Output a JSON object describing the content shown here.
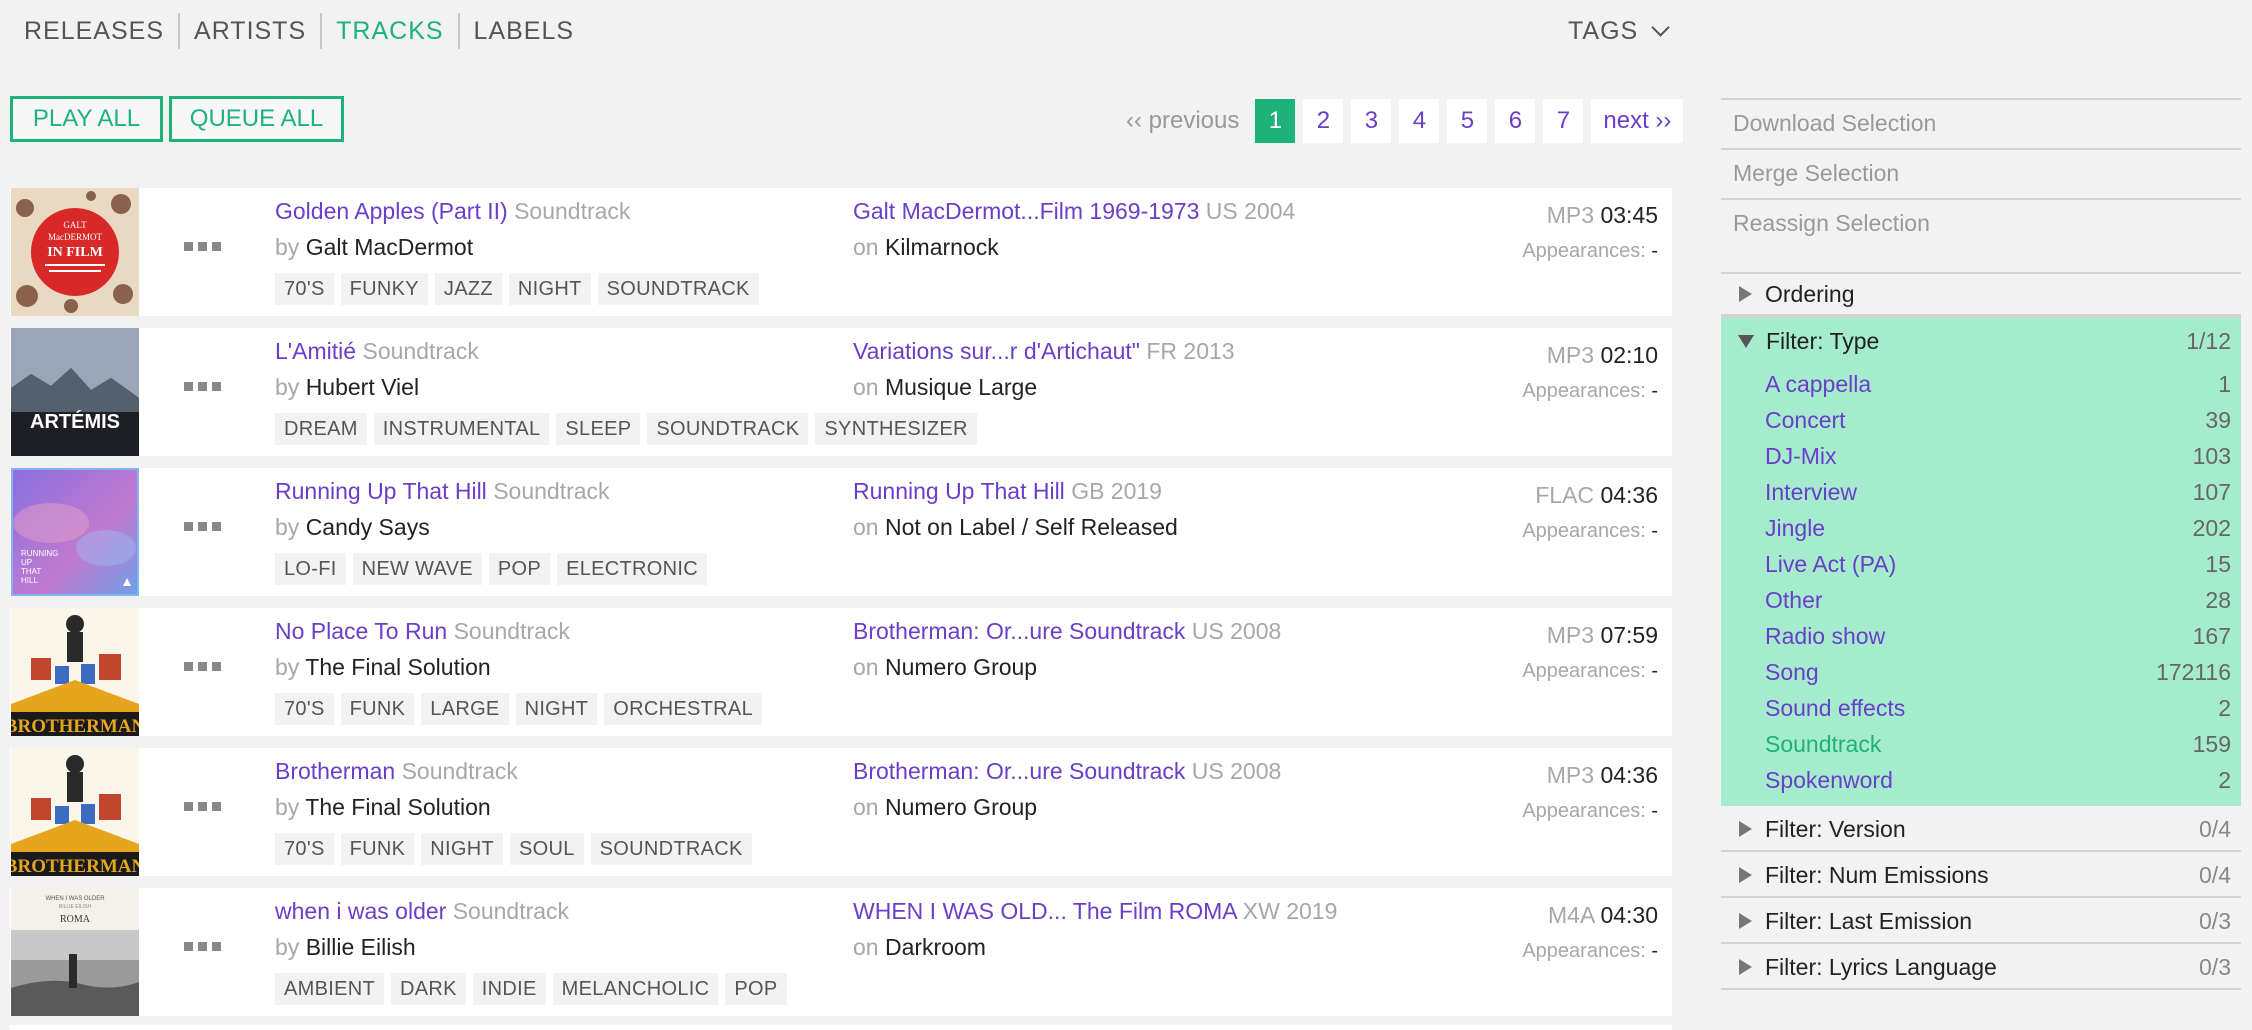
{
  "nav": {
    "items": [
      "RELEASES",
      "ARTISTS",
      "TRACKS",
      "LABELS"
    ],
    "active": "TRACKS",
    "tags_label": "TAGS"
  },
  "actions": {
    "play_all": "PLAY ALL",
    "queue_all": "QUEUE ALL"
  },
  "pagination": {
    "previous": "‹‹ previous",
    "next": "next ››",
    "pages": [
      "1",
      "2",
      "3",
      "4",
      "5",
      "6",
      "7"
    ],
    "current": "1"
  },
  "tracks": [
    {
      "title": "Golden Apples (Part II)",
      "type": "Soundtrack",
      "by_prefix": "by",
      "artist": "Galt MacDermot",
      "tags": [
        "70'S",
        "FUNKY",
        "JAZZ",
        "NIGHT",
        "SOUNDTRACK"
      ],
      "release": "Galt MacDermot...Film 1969-1973",
      "release_meta": "US 2004",
      "on_prefix": "on",
      "label": "Kilmarnock",
      "format": "MP3",
      "duration": "03:45",
      "appearances_label": "Appearances:",
      "appearances": "-",
      "cover_text": [
        "GALT",
        "MacDERMOT",
        "IN FILM"
      ]
    },
    {
      "title": "L'Amitié",
      "type": "Soundtrack",
      "by_prefix": "by",
      "artist": "Hubert Viel",
      "tags": [
        "DREAM",
        "INSTRUMENTAL",
        "SLEEP",
        "SOUNDTRACK",
        "SYNTHESIZER"
      ],
      "release": "Variations sur...r d'Artichaut\"",
      "release_meta": "FR 2013",
      "on_prefix": "on",
      "label": "Musique Large",
      "format": "MP3",
      "duration": "02:10",
      "appearances_label": "Appearances:",
      "appearances": "-",
      "cover_text": [
        "ARTÉMIS"
      ]
    },
    {
      "title": "Running Up That Hill",
      "type": "Soundtrack",
      "by_prefix": "by",
      "artist": "Candy Says",
      "tags": [
        "LO-FI",
        "NEW WAVE",
        "POP",
        "ELECTRONIC"
      ],
      "release": "Running Up That Hill",
      "release_meta": "GB 2019",
      "on_prefix": "on",
      "label": "Not on Label / Self Released",
      "format": "FLAC",
      "duration": "04:36",
      "appearances_label": "Appearances:",
      "appearances": "-",
      "cover_text": [
        "RUNNING",
        "UP",
        "THAT",
        "HILL"
      ]
    },
    {
      "title": "No Place To Run",
      "type": "Soundtrack",
      "by_prefix": "by",
      "artist": "The Final Solution",
      "tags": [
        "70'S",
        "FUNK",
        "LARGE",
        "NIGHT",
        "ORCHESTRAL"
      ],
      "release": "Brotherman: Or...ure Soundtrack",
      "release_meta": "US 2008",
      "on_prefix": "on",
      "label": "Numero Group",
      "format": "MP3",
      "duration": "07:59",
      "appearances_label": "Appearances:",
      "appearances": "-",
      "cover_text": [
        "BROTHERMAN"
      ]
    },
    {
      "title": "Brotherman",
      "type": "Soundtrack",
      "by_prefix": "by",
      "artist": "The Final Solution",
      "tags": [
        "70'S",
        "FUNK",
        "NIGHT",
        "SOUL",
        "SOUNDTRACK"
      ],
      "release": "Brotherman: Or...ure Soundtrack",
      "release_meta": "US 2008",
      "on_prefix": "on",
      "label": "Numero Group",
      "format": "MP3",
      "duration": "04:36",
      "appearances_label": "Appearances:",
      "appearances": "-",
      "cover_text": [
        "BROTHERMAN"
      ]
    },
    {
      "title": "when i was older",
      "type": "Soundtrack",
      "by_prefix": "by",
      "artist": "Billie Eilish",
      "tags": [
        "AMBIENT",
        "DARK",
        "INDIE",
        "MELANCHOLIC",
        "POP"
      ],
      "release": "WHEN I WAS OLD... The Film ROMA",
      "release_meta": "XW 2019",
      "on_prefix": "on",
      "label": "Darkroom",
      "format": "M4A",
      "duration": "04:30",
      "appearances_label": "Appearances:",
      "appearances": "-",
      "cover_text": [
        "WHEN I WAS OLDER",
        "BILLIE EILISH",
        "ROMA"
      ]
    }
  ],
  "selection": [
    "Download Selection",
    "Merge Selection",
    "Reassign Selection"
  ],
  "ordering": {
    "label": "Ordering"
  },
  "filter_type": {
    "label": "Filter: Type",
    "count": "1/12",
    "items": [
      {
        "name": "A cappella",
        "count": "1"
      },
      {
        "name": "Concert",
        "count": "39"
      },
      {
        "name": "DJ-Mix",
        "count": "103"
      },
      {
        "name": "Interview",
        "count": "107"
      },
      {
        "name": "Jingle",
        "count": "202"
      },
      {
        "name": "Live Act (PA)",
        "count": "15"
      },
      {
        "name": "Other",
        "count": "28"
      },
      {
        "name": "Radio show",
        "count": "167"
      },
      {
        "name": "Song",
        "count": "172116"
      },
      {
        "name": "Sound effects",
        "count": "2"
      },
      {
        "name": "Soundtrack",
        "count": "159"
      },
      {
        "name": "Spokenword",
        "count": "2"
      }
    ],
    "selected": "Soundtrack"
  },
  "filters": [
    {
      "label": "Filter: Version",
      "count": "0/4"
    },
    {
      "label": "Filter: Num Emissions",
      "count": "0/4"
    },
    {
      "label": "Filter: Last Emission",
      "count": "0/3"
    },
    {
      "label": "Filter: Lyrics Language",
      "count": "0/3"
    }
  ],
  "colors": {
    "accent": "#1db27a",
    "link": "#6a3ec9",
    "filter_bg": "#a5ecce",
    "muted": "#a7a7a7"
  }
}
